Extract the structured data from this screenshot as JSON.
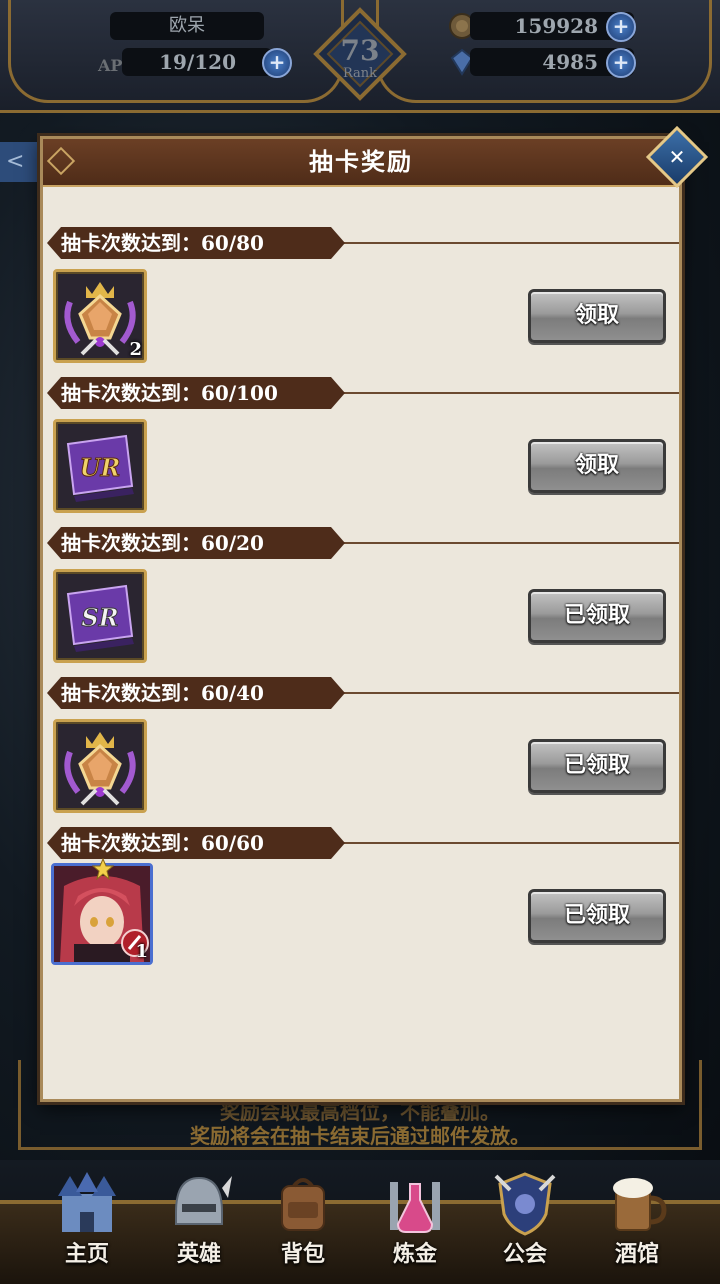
{
  "status_bar": {
    "player_name": "欧呆",
    "ap_label": "AP",
    "ap_value": "19/120",
    "rank_number": "73",
    "rank_label": "Rank",
    "gold": "159928",
    "gems": "4985"
  },
  "modal": {
    "title": "抽卡奖励",
    "rows": [
      {
        "label": "抽卡次数达到：",
        "progress": "60/80",
        "item_icon": "crest-emblem-icon",
        "item_count": "2",
        "button": "领取"
      },
      {
        "label": "抽卡次数达到：",
        "progress": "60/100",
        "item_icon": "ur-ticket-icon",
        "item_count": "",
        "button": "领取"
      },
      {
        "label": "抽卡次数达到：",
        "progress": "60/20",
        "item_icon": "sr-ticket-icon",
        "item_count": "",
        "button": "已领取"
      },
      {
        "label": "抽卡次数达到：",
        "progress": "60/40",
        "item_icon": "crest-emblem-icon",
        "item_count": "",
        "button": "已领取"
      },
      {
        "label": "抽卡次数达到：",
        "progress": "60/60",
        "item_icon": "hero-portrait-icon",
        "item_count": "1",
        "button": "已领取"
      }
    ]
  },
  "notes": {
    "line1": "奖励会取最高档位，不能叠加。",
    "line2": "奖励将会在抽卡结束后通过邮件发放。"
  },
  "bottom_nav": [
    {
      "label": "主页",
      "icon": "castle-icon"
    },
    {
      "label": "英雄",
      "icon": "helmet-icon"
    },
    {
      "label": "背包",
      "icon": "backpack-icon"
    },
    {
      "label": "炼金",
      "icon": "potion-icon"
    },
    {
      "label": "公会",
      "icon": "guild-shield-icon"
    },
    {
      "label": "酒馆",
      "icon": "tavern-mug-icon"
    }
  ],
  "colors": {
    "modal_bg": "#ece7dc",
    "header_brown": "#4f2c18",
    "banner_brown": "#4e2c1a",
    "frame_gold": "#c9a14f"
  }
}
